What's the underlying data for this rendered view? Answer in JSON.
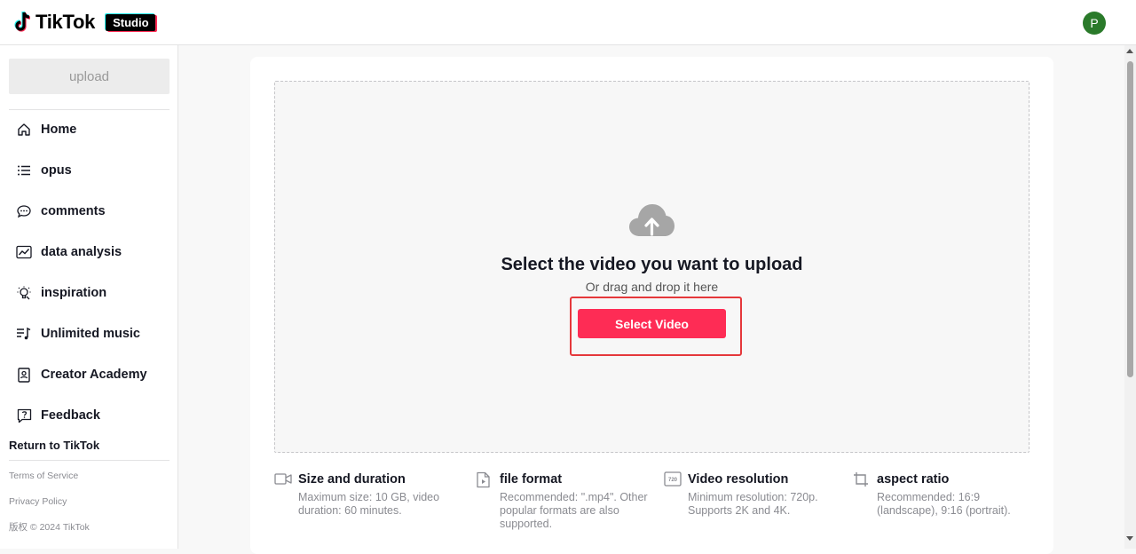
{
  "header": {
    "logo_text": "TikTok",
    "studio_badge": "Studio",
    "avatar_initial": "P"
  },
  "sidebar": {
    "upload_label": "upload",
    "items": [
      {
        "label": "Home",
        "icon": "home-icon"
      },
      {
        "label": "opus",
        "icon": "list-icon"
      },
      {
        "label": "comments",
        "icon": "comment-icon"
      },
      {
        "label": "data analysis",
        "icon": "analytics-icon"
      },
      {
        "label": "inspiration",
        "icon": "lightbulb-icon"
      },
      {
        "label": "Unlimited music",
        "icon": "music-icon"
      },
      {
        "label": "Creator Academy",
        "icon": "academy-icon"
      },
      {
        "label": "Feedback",
        "icon": "feedback-icon"
      }
    ],
    "return_link": "Return to TikTok",
    "footer": {
      "terms": "Terms of Service",
      "privacy": "Privacy Policy",
      "copyright": "版权 © 2024 TikTok"
    }
  },
  "upload": {
    "title": "Select the video you want to upload",
    "subtitle": "Or drag and drop it here",
    "button_label": "Select Video"
  },
  "info": [
    {
      "title": "Size and duration",
      "desc_line1": "Maximum size: 10 GB, video",
      "desc_line2": "duration: 60 minutes.",
      "desc_line3": "",
      "icon": "video-camera-icon"
    },
    {
      "title": "file format",
      "desc_line1": "Recommended: \".mp4\". Other",
      "desc_line2": "popular formats are also",
      "desc_line3": "supported.",
      "icon": "file-play-icon"
    },
    {
      "title": "Video resolution",
      "desc_line1": "Minimum resolution: 720p.",
      "desc_line2": "Supports 2K and 4K.",
      "desc_line3": "",
      "icon": "resolution-720-icon",
      "icon_text": "720"
    },
    {
      "title": "aspect ratio",
      "desc_line1": "Recommended: 16:9",
      "desc_line2": "(landscape), 9:16 (portrait).",
      "desc_line3": "",
      "icon": "crop-icon"
    }
  ],
  "colors": {
    "accent": "#fe2c55",
    "highlight_border": "#e5383b",
    "avatar_bg": "#2a7a2a"
  }
}
